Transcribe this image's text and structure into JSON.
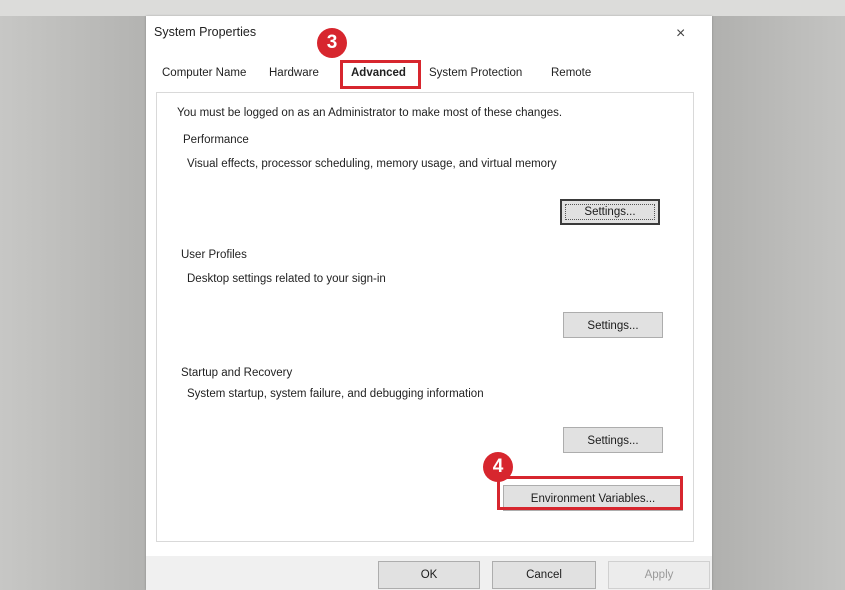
{
  "dialog": {
    "title": "System Properties",
    "close_glyph": "×"
  },
  "tabs": [
    "Computer Name",
    "Hardware",
    "Advanced",
    "System Protection",
    "Remote"
  ],
  "advanced": {
    "admin_note": "You must be logged on as an Administrator to make most of these changes.",
    "performance": {
      "heading": "Performance",
      "description": "Visual effects, processor scheduling, memory usage, and virtual memory",
      "button": "Settings..."
    },
    "user_profiles": {
      "heading": "User Profiles",
      "description": "Desktop settings related to your sign-in",
      "button": "Settings..."
    },
    "startup_recovery": {
      "heading": "Startup and Recovery",
      "description": "System startup, system failure, and debugging information",
      "button": "Settings..."
    },
    "env_button": "Environment Variables..."
  },
  "footer": {
    "ok": "OK",
    "cancel": "Cancel",
    "apply": "Apply"
  },
  "annotations": {
    "marker_tab": "3",
    "marker_env": "4",
    "highlight_color": "#d7262e"
  }
}
